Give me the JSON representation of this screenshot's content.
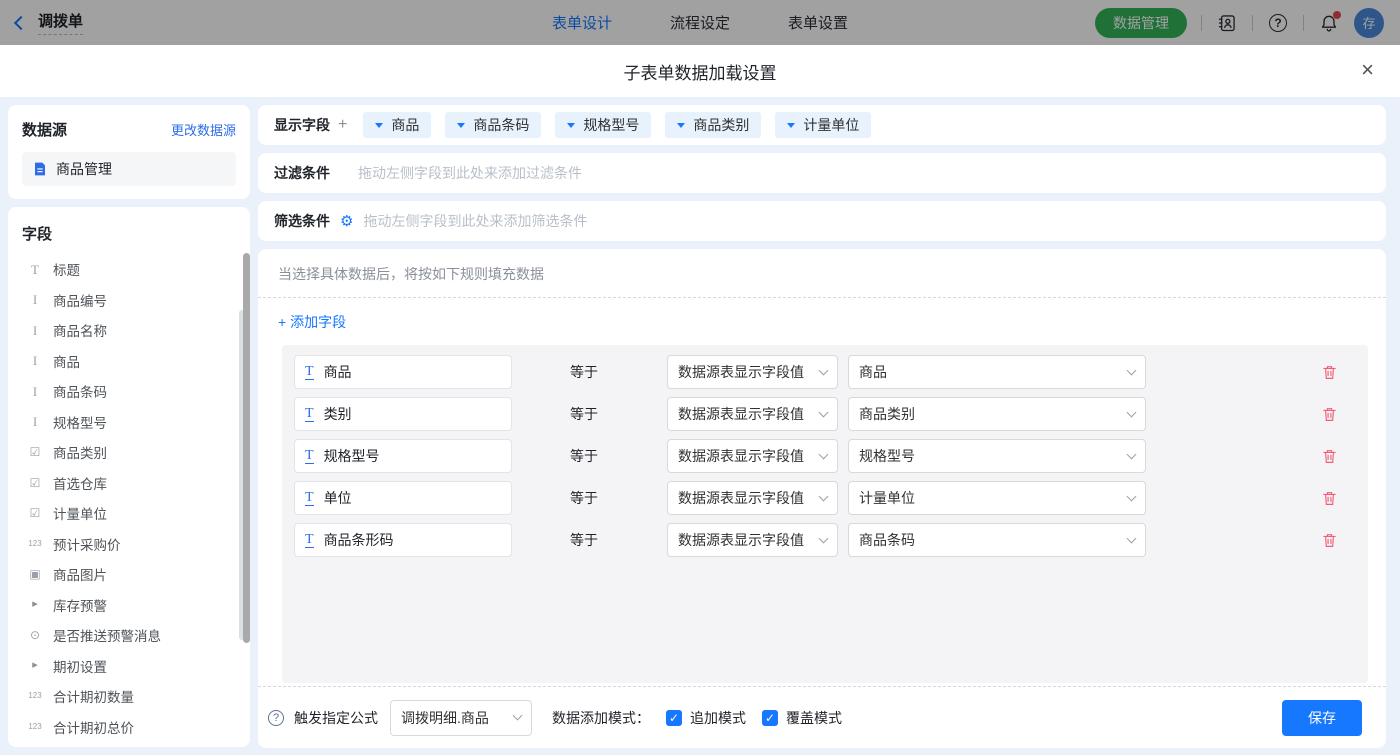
{
  "colors": {
    "primary": "#1677ff",
    "green": "#34b457",
    "danger": "#f25c77"
  },
  "topbar": {
    "back_label": "调拨单",
    "tabs": [
      {
        "label": "表单设计",
        "active": true
      },
      {
        "label": "流程设定",
        "active": false
      },
      {
        "label": "表单设置",
        "active": false
      }
    ],
    "data_manage_label": "数据管理",
    "help_glyph": "?",
    "avatar_text": "存"
  },
  "modal": {
    "title": "子表单数据加载设置",
    "close_glyph": "×"
  },
  "sidebar": {
    "datasource": {
      "title": "数据源",
      "change_link": "更改数据源",
      "item": "商品管理"
    },
    "fields_title": "字段",
    "fields": [
      {
        "label": "标题",
        "icon": "title-icon"
      },
      {
        "label": "商品编号",
        "icon": "text-field-icon"
      },
      {
        "label": "商品名称",
        "icon": "text-field-icon"
      },
      {
        "label": "商品",
        "icon": "text-field-icon"
      },
      {
        "label": "商品条码",
        "icon": "text-field-icon"
      },
      {
        "label": "规格型号",
        "icon": "text-field-icon"
      },
      {
        "label": "商品类别",
        "icon": "select-icon"
      },
      {
        "label": "首选仓库",
        "icon": "select-icon"
      },
      {
        "label": "计量单位",
        "icon": "select-icon"
      },
      {
        "label": "预计采购价",
        "icon": "number-icon"
      },
      {
        "label": "商品图片",
        "icon": "image-icon"
      },
      {
        "label": "库存预警",
        "icon": "group-icon"
      },
      {
        "label": "是否推送预警消息",
        "icon": "radio-icon"
      },
      {
        "label": "期初设置",
        "icon": "group-icon"
      },
      {
        "label": "合计期初数量",
        "icon": "number-icon"
      },
      {
        "label": "合计期初总价",
        "icon": "number-icon"
      }
    ]
  },
  "display": {
    "label": "显示字段",
    "add_glyph": "+",
    "tags": [
      "商品",
      "商品条码",
      "规格型号",
      "商品类别",
      "计量单位"
    ]
  },
  "filter": {
    "label": "过滤条件",
    "placeholder": "拖动左侧字段到此处来添加过滤条件"
  },
  "sift": {
    "label": "筛选条件",
    "gear_glyph": "⚙",
    "placeholder": "拖动左侧字段到此处来添加筛选条件"
  },
  "rules": {
    "note": "当选择具体数据后，将按如下规则填充数据",
    "add_field": "+ 添加字段",
    "operator": "等于",
    "rows": [
      {
        "field": "商品",
        "source": "数据源表显示字段值",
        "value": "商品"
      },
      {
        "field": "类别",
        "source": "数据源表显示字段值",
        "value": "商品类别"
      },
      {
        "field": "规格型号",
        "source": "数据源表显示字段值",
        "value": "规格型号"
      },
      {
        "field": "单位",
        "source": "数据源表显示字段值",
        "value": "计量单位"
      },
      {
        "field": "商品条形码",
        "source": "数据源表显示字段值",
        "value": "商品条码"
      }
    ]
  },
  "footer": {
    "help_glyph": "?",
    "trigger_label": "触发指定公式",
    "trigger_value": "调拨明细.商品",
    "mode_label": "数据添加模式：",
    "append_label": "追加模式",
    "append_checked": true,
    "override_label": "覆盖模式",
    "override_checked": true,
    "check_glyph": "✓",
    "save_label": "保存"
  }
}
